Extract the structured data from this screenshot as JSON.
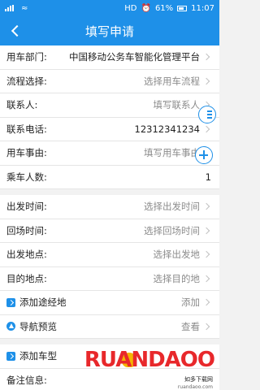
{
  "status_bar": {
    "left": "HD",
    "battery": "61%",
    "time": "11:07"
  },
  "header": {
    "title": "填写申请"
  },
  "form": {
    "department": {
      "label": "用车部门:",
      "value": "中国移动公务车智能化管理平台"
    },
    "process": {
      "label": "流程选择:",
      "placeholder": "选择用车流程"
    },
    "contact": {
      "label": "联系人:",
      "placeholder": "填写联系人"
    },
    "phone": {
      "label": "联系电话:",
      "value": "12312341234"
    },
    "reason": {
      "label": "用车事由:",
      "placeholder": "填写用车事由"
    },
    "passengers": {
      "label": "乘车人数:",
      "value": "1"
    },
    "depart_time": {
      "label": "出发时间:",
      "placeholder": "选择出发时间"
    },
    "return_time": {
      "label": "回场时间:",
      "placeholder": "选择回场时间"
    },
    "depart_place": {
      "label": "出发地点:",
      "placeholder": "选择出发地"
    },
    "destination": {
      "label": "目的地点:",
      "placeholder": "选择目的地"
    },
    "waypoint": {
      "label": "添加途经地",
      "action": "添加"
    },
    "nav_preview": {
      "label": "导航预览",
      "action": "查看"
    },
    "car_type": {
      "label": "添加车型"
    },
    "remark": {
      "label": "备注信息:"
    }
  },
  "watermark": {
    "brand": "RUANDAOO",
    "slogan": "如多下载网",
    "site": "ruandaoo.com"
  },
  "colors": {
    "primary": "#1e90e8",
    "watermark": "#e8282b"
  }
}
